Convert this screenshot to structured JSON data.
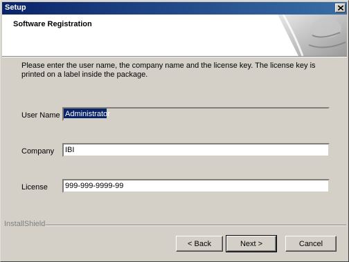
{
  "window": {
    "title": "Setup"
  },
  "header": {
    "title": "Software Registration"
  },
  "instructions": "Please enter the user name, the company name and the license key. The license key is printed on a label inside the package.",
  "fields": {
    "username": {
      "label": "User Name",
      "value": "Administrator"
    },
    "company": {
      "label": "Company",
      "value": "IBI"
    },
    "license": {
      "label": "License",
      "value": "999-999-9999-99"
    }
  },
  "brand": "InstallShield",
  "buttons": {
    "back": "< Back",
    "next": "Next >",
    "cancel": "Cancel"
  }
}
